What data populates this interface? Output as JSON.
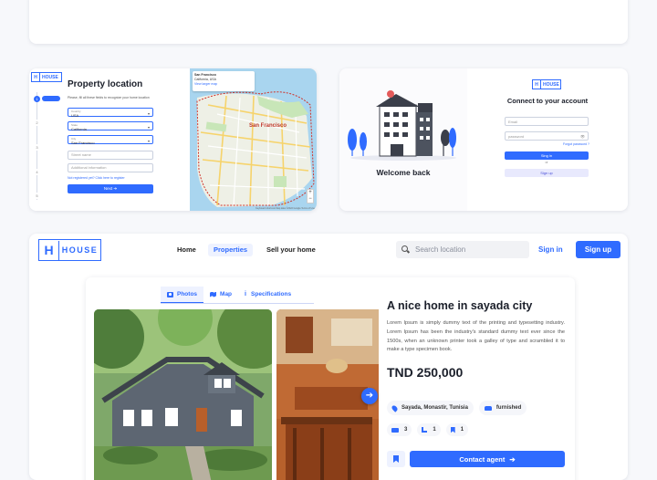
{
  "property_location": {
    "logo_text": "HOUSE",
    "title": "Property location",
    "description": "Please, fill all these fields to recognize your home location",
    "country_caption": "Country",
    "country": "USA",
    "state_caption": "State",
    "state": "California",
    "city_caption": "City",
    "city": "San Francisco",
    "street_placeholder": "Street name",
    "additional_placeholder": "Additional information",
    "link": "Not registered yet? Click here to register",
    "next_label": "Next",
    "steps": [
      "1",
      "2",
      "3",
      "4",
      "5"
    ],
    "map_popup_title": "San Francisco",
    "map_popup_sub": "California, USA",
    "map_popup_link": "View larger map",
    "map_city_label": "San Francisco",
    "map_attribution": "Keyboard shortcuts  Map data ©2022 Google  Terms of Use"
  },
  "login": {
    "welcome": "Welcome back",
    "logo_text": "HOUSE",
    "title": "Connect to your account",
    "email_placeholder": "Email",
    "password_placeholder": "password",
    "forgot": "Forgot password ?",
    "signin_label": "Sing in",
    "or": "or",
    "signup_label": "Sign up"
  },
  "header": {
    "logo_text": "HOUSE",
    "nav": [
      "Home",
      "Properties",
      "Sell your home"
    ],
    "search_placeholder": "Search location",
    "signin": "Sign in",
    "signup": "Sign up"
  },
  "listing": {
    "tabs": [
      "Photos",
      "Map",
      "Specifications"
    ],
    "title": "A nice home in sayada city",
    "description": "Lorem Ipsum is simply dummy text of the printing and typesetting industry. Lorem Ipsum has been the industry's standard dummy text ever since the 1500s, when an unknown printer took a galley of type and scrambled it to make a type specimen book.",
    "price": "TND 250,000",
    "location": "Sayada, Monastir, Tunisia",
    "furnishing": "furnished",
    "bedrooms": "3",
    "bathrooms": "1",
    "saved": "1",
    "contact_label": "Contact agent"
  },
  "colors": {
    "accent": "#2f6bff",
    "accent_light": "#eef2ff",
    "text": "#1b1f2a"
  }
}
